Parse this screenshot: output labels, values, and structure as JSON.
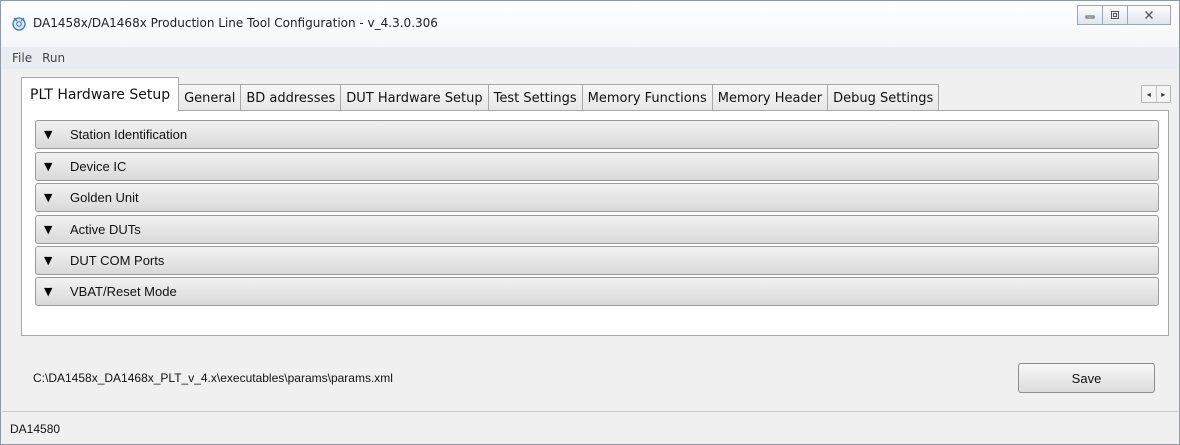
{
  "window": {
    "title": "DA1458x/DA1468x Production Line Tool Configuration - v_4.3.0.306",
    "app_icon": "gear-app-icon",
    "controls": [
      "minimize-icon",
      "restore-icon",
      "close-icon"
    ]
  },
  "menu": {
    "items": [
      {
        "label": "File"
      },
      {
        "label": "Run"
      }
    ]
  },
  "tabs": {
    "items": [
      {
        "label": "PLT Hardware Setup",
        "active": true
      },
      {
        "label": "General"
      },
      {
        "label": "BD addresses"
      },
      {
        "label": "DUT Hardware Setup"
      },
      {
        "label": "Test Settings"
      },
      {
        "label": "Memory Functions"
      },
      {
        "label": "Memory Header"
      },
      {
        "label": "Debug Settings"
      }
    ],
    "scroll_left": "◂",
    "scroll_right": "▸"
  },
  "sections": {
    "expand_glyph": "▼",
    "items": [
      {
        "label": "Station Identification"
      },
      {
        "label": "Device IC"
      },
      {
        "label": "Golden Unit"
      },
      {
        "label": "Active DUTs"
      },
      {
        "label": "DUT COM Ports"
      },
      {
        "label": "VBAT/Reset Mode"
      }
    ]
  },
  "footer": {
    "path": "C:\\DA1458x_DA1468x_PLT_v_4.x\\executables\\params\\params.xml",
    "save_label": "Save"
  },
  "status": {
    "text": "DA14580"
  }
}
